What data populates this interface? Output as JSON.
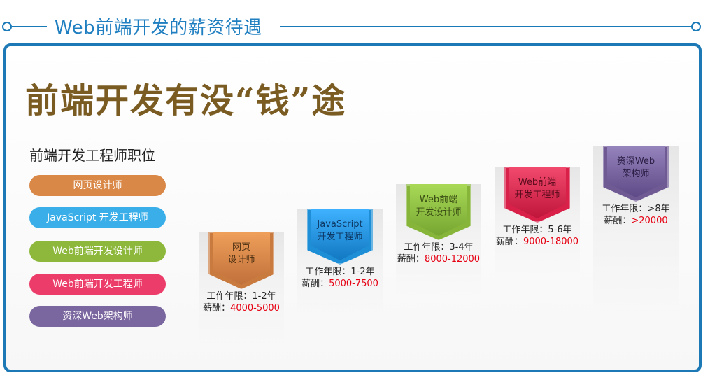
{
  "header": {
    "title": "Web前端开发的薪资待遇"
  },
  "main": {
    "title": "前端开发有没“钱”途",
    "positions_title": "前端开发工程师职位",
    "positions": [
      {
        "label": "网页设计师",
        "color": "#d98848"
      },
      {
        "label": "JavaScript 开发工程师",
        "color": "#3aaee8"
      },
      {
        "label": "Web前端开发设计师",
        "color": "#8db83c"
      },
      {
        "label": "Web前端开发工程师",
        "color": "#ec3d6a"
      },
      {
        "label": "资深Web架构师",
        "color": "#7b679f"
      }
    ],
    "levels": [
      {
        "line1": "网页",
        "line2": "设计师",
        "years_label": "工作年限：",
        "years": "1-2年",
        "salary_label": "薪酬：",
        "salary": "4000-5000",
        "color": "#c97a3e"
      },
      {
        "line1": "JavaScript",
        "line2": "开发工程师",
        "years_label": "工作年限：",
        "years": "1-2年",
        "salary_label": "薪酬：",
        "salary": "5000-7500",
        "color": "#1e8fd6"
      },
      {
        "line1": "Web前端",
        "line2": "开发设计师",
        "years_label": "工作年限：",
        "years": "3-4年",
        "salary_label": "薪酬：",
        "salary": "8000-12000",
        "color": "#86b53a"
      },
      {
        "line1": "Web前端",
        "line2": "开发工程师",
        "years_label": "工作年限：",
        "years": "5-6年",
        "salary_label": "薪酬：",
        "salary": "9000-18000",
        "color": "#d82048"
      },
      {
        "line1": "资深Web",
        "line2": "架构师",
        "years_label": "工作年限：",
        "years": ">8年",
        "salary_label": "薪酬：",
        "salary": ">20000",
        "color": "#6f5a94"
      }
    ]
  }
}
